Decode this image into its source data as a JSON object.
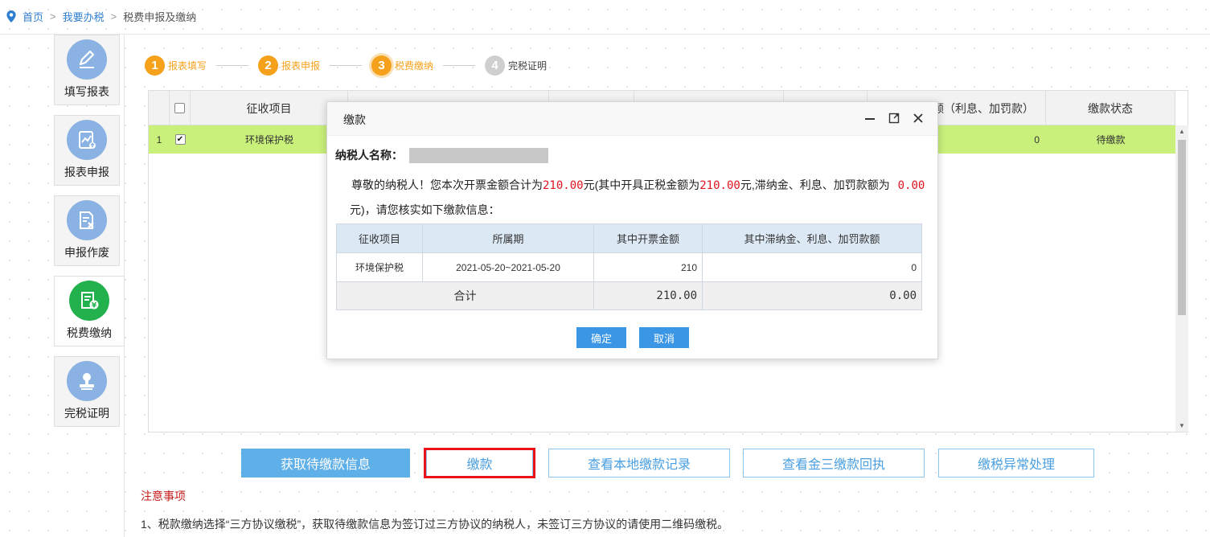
{
  "breadcrumb": {
    "home": "首页",
    "level2": "我要办税",
    "current": "税费申报及缴纳",
    "separator": ">"
  },
  "sidebar": {
    "items": [
      {
        "label": "填写报表",
        "icon": "pencil-icon"
      },
      {
        "label": "报表申报",
        "icon": "report-chart-icon"
      },
      {
        "label": "申报作废",
        "icon": "document-cancel-icon"
      },
      {
        "label": "税费缴纳",
        "icon": "tax-payment-icon",
        "active": true
      },
      {
        "label": "完税证明",
        "icon": "stamp-icon"
      }
    ]
  },
  "steps": [
    {
      "num": "1",
      "label": "报表填写",
      "state": "done"
    },
    {
      "num": "2",
      "label": "报表申报",
      "state": "done"
    },
    {
      "num": "3",
      "label": "税费缴纳",
      "state": "current"
    },
    {
      "num": "4",
      "label": "完税证明",
      "state": "todo"
    }
  ],
  "table": {
    "headers": {
      "item": "征收项目",
      "penalty_partial": "额（利息、加罚款）",
      "status": "缴款状态"
    },
    "row": {
      "index": "1",
      "checked": true,
      "item": "环境保护税",
      "penalty": "0",
      "status": "待缴款"
    }
  },
  "buttons": {
    "get_pending": "获取待缴款信息",
    "pay": "缴款",
    "local_records": "查看本地缴款记录",
    "jinsan_receipt": "查看金三缴款回执",
    "exception": "缴税异常处理"
  },
  "notice": {
    "title": "注意事项",
    "line1": "1、税款缴纳选择“三方协议缴税”，获取待缴款信息为签订过三方协议的纳税人，未签订三方协议的请使用二维码缴税。"
  },
  "modal": {
    "title": "缴款",
    "taxpayer_label": "纳税人名称：",
    "msg_a": "尊敬的纳税人！您本次开票金额合计为",
    "amount_total": "210.00",
    "msg_b": "元(其中开具正税金额为",
    "amount_tax": "210.00",
    "msg_c": "元,滞纳金、利息、加罚款额为",
    "amount_penalty": "0.00",
    "msg_d": "元)，请您核实如下缴款信息：",
    "table": {
      "headers": [
        "征收项目",
        "所属期",
        "其中开票金额",
        "其中滞纳金、利息、加罚款额"
      ],
      "row": [
        "环境保护税",
        "2021-05-20~2021-05-20",
        "210",
        "0"
      ],
      "total_label": "合计",
      "total_amount": "210.00",
      "total_penalty": "0.00"
    },
    "confirm": "确定",
    "cancel": "取消"
  },
  "colors": {
    "accent": "#5fafe8",
    "step": "#f5a11b",
    "row_highlight": "#c9f07b",
    "alert": "#e8141a"
  }
}
